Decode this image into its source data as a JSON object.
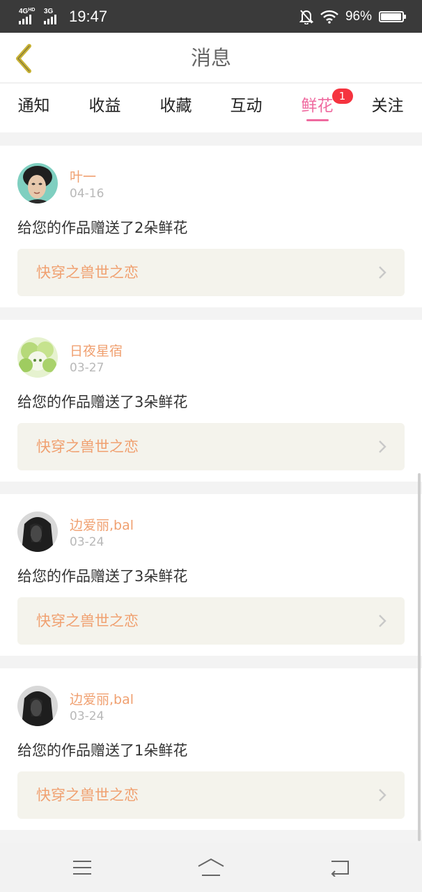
{
  "status_bar": {
    "net1": "4G",
    "net1_sup": "HD",
    "net2": "3G",
    "time": "19:47",
    "battery_text": "96%",
    "battery_level": 0.96
  },
  "header": {
    "title": "消息",
    "back_icon": "chevron-left-icon"
  },
  "tabs": [
    {
      "label": "通知"
    },
    {
      "label": "收益"
    },
    {
      "label": "收藏"
    },
    {
      "label": "互动"
    },
    {
      "label": "鲜花",
      "active": true,
      "badge": "1"
    },
    {
      "label": "关注"
    }
  ],
  "messages": [
    {
      "user": "叶一",
      "date": "04-16",
      "text": "给您的作品赠送了2朵鲜花",
      "work": "快穿之兽世之恋"
    },
    {
      "user": "日夜星宿",
      "date": "03-27",
      "text": "给您的作品赠送了3朵鲜花",
      "work": "快穿之兽世之恋"
    },
    {
      "user": "边爱丽,bal",
      "date": "03-24",
      "text": "给您的作品赠送了3朵鲜花",
      "work": "快穿之兽世之恋"
    },
    {
      "user": "边爱丽,bal",
      "date": "03-24",
      "text": "给您的作品赠送了1朵鲜花",
      "work": "快穿之兽世之恋"
    }
  ],
  "colors": {
    "accent_pink": "#ef6a9f",
    "name_orange": "#f0a070",
    "badge_red": "#f5333f",
    "back_arrow_yellow": "#c9b336"
  },
  "navbar": {
    "menu_icon": "menu-icon",
    "home_icon": "home-icon",
    "back_icon": "back-icon"
  }
}
